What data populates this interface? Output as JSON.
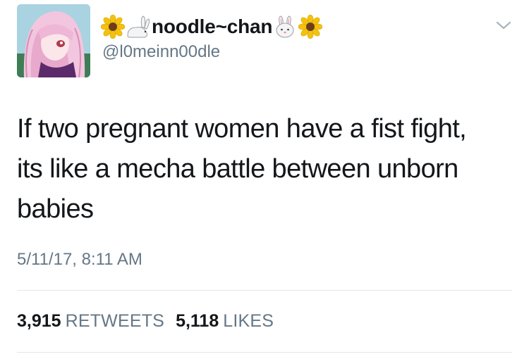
{
  "user": {
    "display_name": "noodle~chan",
    "handle": "@l0meinn00dle",
    "avatar_icon": "anime-girl-avatar",
    "name_emojis": [
      "sunflower-icon",
      "rabbit-icon",
      "rabbit-face-icon",
      "sunflower-icon"
    ]
  },
  "tweet": {
    "text": "If two pregnant women have a fist fight,\nits like a mecha battle between unborn\nbabies",
    "timestamp": "5/11/17, 8:11 AM"
  },
  "stats": {
    "retweets_count": "3,915",
    "retweets_label": "RETWEETS",
    "likes_count": "5,118",
    "likes_label": "LIKES"
  },
  "colors": {
    "text_primary": "#14171a",
    "text_secondary": "#657786",
    "divider": "#e1e8ed",
    "sunflower_petal": "#f4c20d",
    "sunflower_center": "#6b3e1f"
  }
}
